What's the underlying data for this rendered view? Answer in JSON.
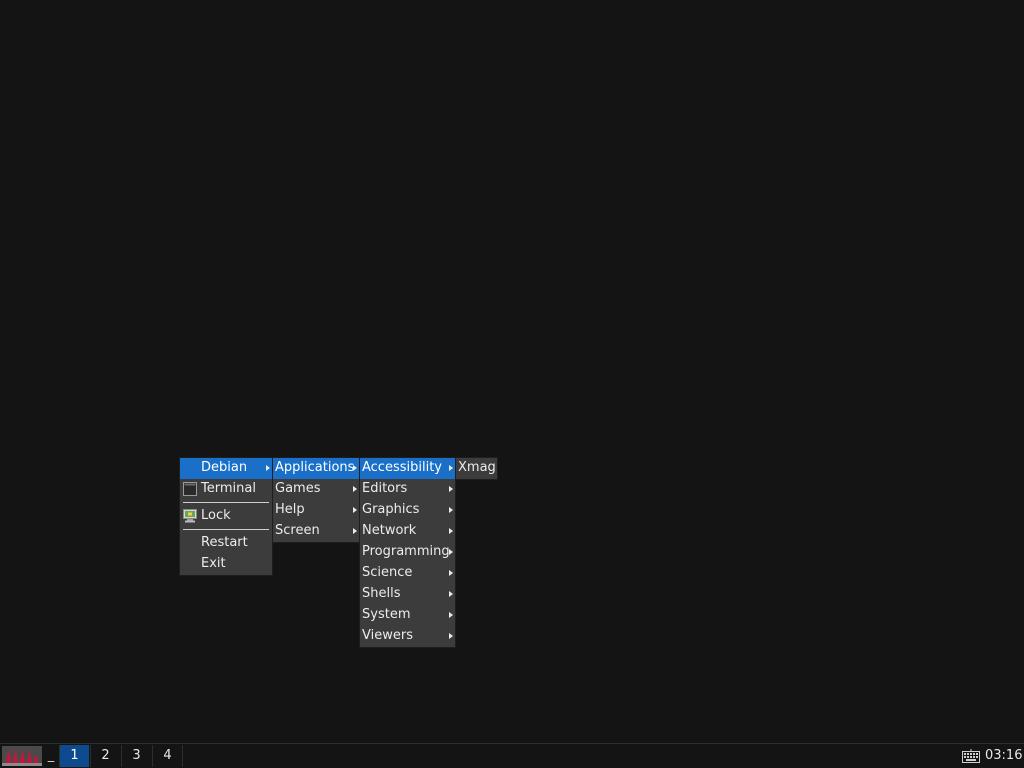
{
  "root_menu": {
    "items": [
      {
        "label": "Debian"
      },
      {
        "label": "Terminal",
        "icon": "terminal-icon"
      },
      {
        "label": "Lock",
        "icon": "lock-screen-icon"
      },
      {
        "label": "Restart"
      },
      {
        "label": "Exit"
      }
    ]
  },
  "debian_menu": {
    "items": [
      {
        "label": "Applications"
      },
      {
        "label": "Games"
      },
      {
        "label": "Help"
      },
      {
        "label": "Screen"
      }
    ]
  },
  "applications_menu": {
    "items": [
      {
        "label": "Accessibility"
      },
      {
        "label": "Editors"
      },
      {
        "label": "Graphics"
      },
      {
        "label": "Network"
      },
      {
        "label": "Programming"
      },
      {
        "label": "Science"
      },
      {
        "label": "Shells"
      },
      {
        "label": "System"
      },
      {
        "label": "Viewers"
      }
    ]
  },
  "accessibility_menu": {
    "items": [
      {
        "label": "Xmag"
      }
    ]
  },
  "taskbar": {
    "minimize_label": "_",
    "workspaces": [
      {
        "label": "1",
        "active": true
      },
      {
        "label": "2"
      },
      {
        "label": "3"
      },
      {
        "label": "4"
      }
    ],
    "keyboard_icon": "keyboard-icon",
    "clock": "03:16"
  },
  "colors": {
    "desktop_bg": "#141414",
    "menu_bg": "#3c3c3c",
    "highlight": "#1a70c8",
    "active_workspace": "#0d4a8e",
    "logo_red": "#c8143c"
  }
}
